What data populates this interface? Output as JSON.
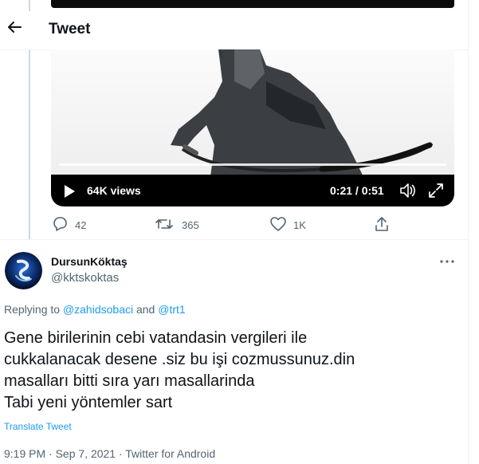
{
  "header": {
    "title": "Tweet",
    "back_icon": "arrow-left-icon"
  },
  "video": {
    "views": "64K views",
    "time": "0:21 / 0:51",
    "icons": [
      "play-icon",
      "volume-icon",
      "fullscreen-icon"
    ]
  },
  "actions": [
    {
      "icon": "reply-icon",
      "count": "42"
    },
    {
      "icon": "retweet-icon",
      "count": "365"
    },
    {
      "icon": "like-icon",
      "count": "1K"
    },
    {
      "icon": "share-icon",
      "count": ""
    }
  ],
  "reply": {
    "author_name": "DursunKöktaş",
    "author_handle": "@kktskoktas",
    "replying_prefix": "Replying to ",
    "mention1": "@zahidsobaci",
    "and": " and ",
    "mention2": "@trt1",
    "text": "Gene birilerinin cebi vatandasin vergileri ile\ncukkalanacak desene .siz bu işi cozmussunuz.din\nmasalları bitti sıra yarı masallarinda\nTabi yeni yöntemler sart",
    "translate": "Translate Tweet",
    "meta": "9:19 PM · Sep 7, 2021 · Twitter for Android"
  },
  "colors": {
    "accent": "#1d9bf0",
    "secondary_text": "#536471"
  }
}
